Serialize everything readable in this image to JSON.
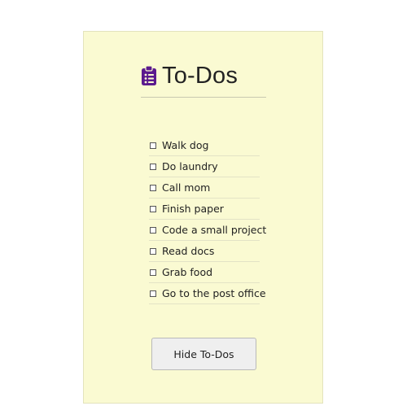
{
  "header": {
    "icon": "clipboard-list-icon",
    "icon_color": "#5b1a8e",
    "title": "To-Dos"
  },
  "todos": [
    {
      "label": "Walk dog",
      "checked": false
    },
    {
      "label": "Do laundry",
      "checked": false
    },
    {
      "label": "Call mom",
      "checked": false
    },
    {
      "label": "Finish paper",
      "checked": false
    },
    {
      "label": "Code a small project",
      "checked": false
    },
    {
      "label": "Read docs",
      "checked": false
    },
    {
      "label": "Grab food",
      "checked": false
    },
    {
      "label": "Go to the post office",
      "checked": false
    }
  ],
  "actions": {
    "toggle_label": "Hide To-Dos"
  },
  "colors": {
    "card_background": "#fafad2",
    "page_background": "#ffffff",
    "text": "#222222"
  }
}
